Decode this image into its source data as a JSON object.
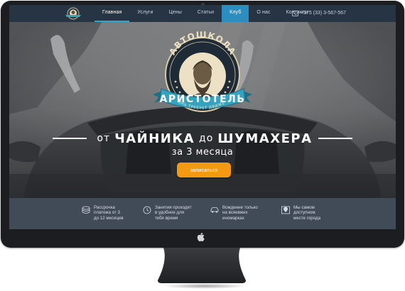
{
  "nav": {
    "items": [
      {
        "label": "Главная"
      },
      {
        "label": "Услуги"
      },
      {
        "label": "Цены"
      },
      {
        "label": "Статьи"
      },
      {
        "label": "Клуб"
      },
      {
        "label": "О нас"
      },
      {
        "label": "Контакты"
      }
    ],
    "phone": "+375 (33) 3-567-567"
  },
  "emblem": {
    "top_text": "АВТОШКОЛА",
    "ribbon_text": "АРИСТОТЕЛЬ",
    "motto": "ЖИЗНЬ ТРЕБУЕТ ДВИЖЕНИЯ"
  },
  "hero": {
    "from": "от",
    "word1": "ЧАЙНИКА",
    "to": "до",
    "word2": "ШУМАХЕРА",
    "subline": "за 3 месяца",
    "cta": "записаться"
  },
  "features": [
    {
      "icon": "coin-icon",
      "text": "Рассрочка\nплатежа от 3\nдо 12 месяцев"
    },
    {
      "icon": "clock-icon",
      "text": "Занятия проходят\nв удобное для\nтебя время"
    },
    {
      "icon": "car-icon",
      "text": "Вождение только\nна всяевжих\nиномарках"
    },
    {
      "icon": "map-pin-icon",
      "text": "Мы самом\nдоступном\nместе города"
    }
  ],
  "colors": {
    "navbar": "#263444",
    "accent_blue": "#2b8ec0",
    "cta_orange": "#f39a12",
    "features_bar": "#414a57"
  }
}
